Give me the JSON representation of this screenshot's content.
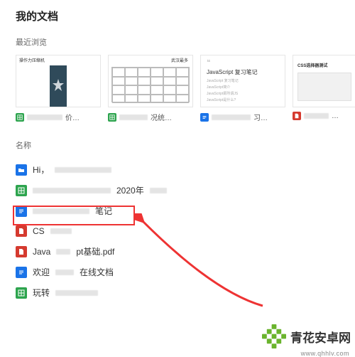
{
  "page_title": "我的文档",
  "sections": {
    "recent": "最近浏览",
    "name": "名称"
  },
  "recent": [
    {
      "icon": "g",
      "label_suffix": "价…",
      "thumb_label": "操作力压缩机"
    },
    {
      "icon": "g",
      "label_suffix": "况统…",
      "thumb_label": "武汉最多"
    },
    {
      "icon": "b",
      "label_suffix": "习…",
      "thumb_title": "JavaScript 复习笔记",
      "thumb_lines": [
        "JavaScript 复习笔记",
        "JavaScript简介",
        "JavaScript即所谓JS",
        "JavaScript是什么?"
      ]
    },
    {
      "icon": "r",
      "label_suffix": "…",
      "thumb_label": "CSS选择器测试"
    }
  ],
  "files": [
    {
      "icon": "bl",
      "type": "folder",
      "prefix": "Hi，"
    },
    {
      "icon": "g",
      "type": "sheet",
      "prefix": "",
      "suffix": "2020年"
    },
    {
      "icon": "b",
      "type": "doc",
      "prefix": "",
      "suffix": "笔记",
      "highlighted": true
    },
    {
      "icon": "r",
      "type": "pdf",
      "prefix": "CS"
    },
    {
      "icon": "r",
      "type": "pdf",
      "prefix": "Java",
      "mid": "pt基础.pdf"
    },
    {
      "icon": "b",
      "type": "doc",
      "prefix": "欢迎",
      "suffix": "在线文档"
    },
    {
      "icon": "g",
      "type": "sheet",
      "prefix": "玩转"
    }
  ],
  "watermark": {
    "text": "青花安卓网",
    "url": "www.qhhlv.com"
  }
}
